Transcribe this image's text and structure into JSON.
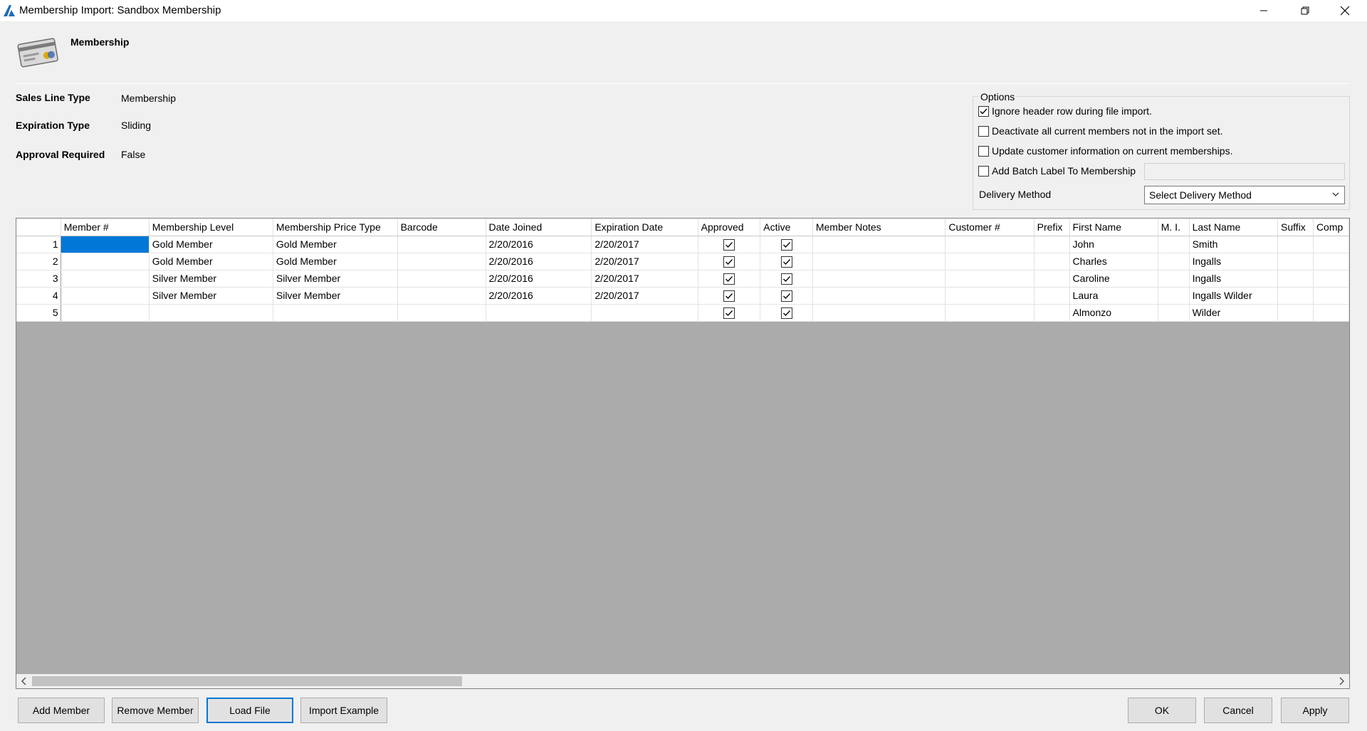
{
  "window": {
    "title": "Membership Import: Sandbox Membership",
    "minimize_icon": "minimize-icon",
    "maximize_icon": "restore-icon",
    "close_icon": "close-icon"
  },
  "header": {
    "title": "Membership",
    "icon": "membership-card-icon"
  },
  "info": {
    "sales_line_type_label": "Sales Line Type",
    "sales_line_type_value": "Membership",
    "expiration_type_label": "Expiration Type",
    "expiration_type_value": "Sliding",
    "approval_required_label": "Approval Required",
    "approval_required_value": "False"
  },
  "options": {
    "legend": "Options",
    "ignore_header": {
      "label": "Ignore header row during file import.",
      "checked": true
    },
    "deactivate_members": {
      "label": "Deactivate all current members not in the import set.",
      "checked": false
    },
    "update_customer": {
      "label": "Update customer information on current memberships.",
      "checked": false
    },
    "add_batch_label": {
      "label": "Add Batch Label To Membership",
      "checked": false
    },
    "batch_label_value": "",
    "delivery_method_label": "Delivery Method",
    "delivery_method_value": "Select Delivery Method"
  },
  "grid": {
    "columns": [
      "",
      "Member #",
      "Membership Level",
      "Membership Price Type",
      "Barcode",
      "Date Joined",
      "Expiration Date",
      "Approved",
      "Active",
      "Member Notes",
      "Customer #",
      "Prefix",
      "First Name",
      "M. I.",
      "Last Name",
      "Suffix",
      "Comp"
    ],
    "rows": [
      [
        "1",
        "",
        "Gold Member",
        "Gold Member",
        "",
        "2/20/2016",
        "2/20/2017",
        true,
        true,
        "",
        "",
        "",
        "John",
        "",
        "Smith",
        "",
        ""
      ],
      [
        "2",
        "",
        "Gold Member",
        "Gold Member",
        "",
        "2/20/2016",
        "2/20/2017",
        true,
        true,
        "",
        "",
        "",
        "Charles",
        "",
        "Ingalls",
        "",
        ""
      ],
      [
        "3",
        "",
        "Silver Member",
        "Silver Member",
        "",
        "2/20/2016",
        "2/20/2017",
        true,
        true,
        "",
        "",
        "",
        "Caroline",
        "",
        "Ingalls",
        "",
        ""
      ],
      [
        "4",
        "",
        "Silver Member",
        "Silver Member",
        "",
        "2/20/2016",
        "2/20/2017",
        true,
        true,
        "",
        "",
        "",
        "Laura",
        "",
        "Ingalls Wilder",
        "",
        ""
      ],
      [
        "5",
        "",
        "",
        "",
        "",
        "",
        "",
        true,
        true,
        "",
        "",
        "",
        "Almonzo",
        "",
        "Wilder",
        "",
        ""
      ]
    ]
  },
  "buttons": {
    "add_member": "Add Member",
    "remove_member": "Remove Member",
    "load_file": "Load File",
    "import_example": "Import Example",
    "ok": "OK",
    "cancel": "Cancel",
    "apply": "Apply"
  },
  "colors": {
    "selection": "#0078d7",
    "grid_background": "#ababab",
    "window_background": "#f0f0f0"
  }
}
